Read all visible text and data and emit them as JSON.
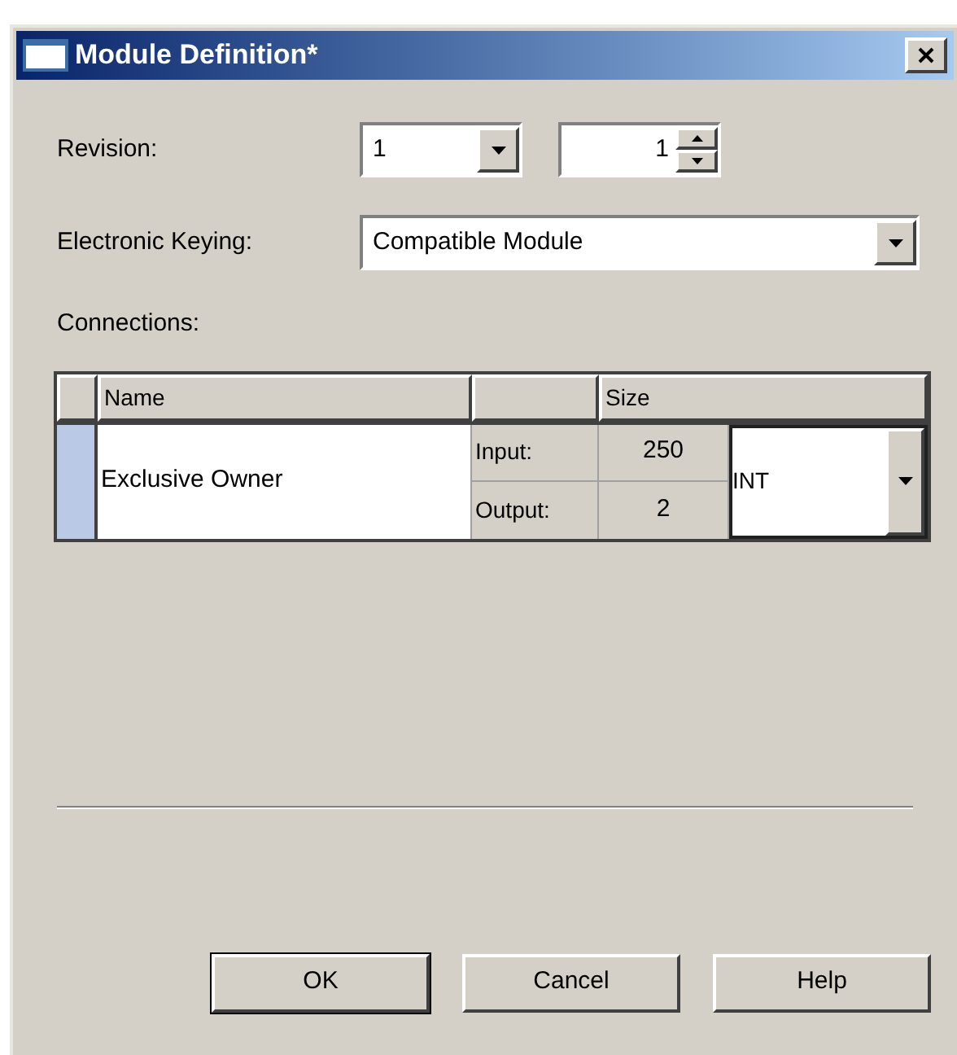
{
  "window": {
    "title": "Module Definition*"
  },
  "revision": {
    "label": "Revision:",
    "major": "1",
    "minor": "1"
  },
  "electronic_keying": {
    "label": "Electronic Keying:",
    "value": "Compatible Module"
  },
  "connections": {
    "label": "Connections:",
    "columns": [
      "Name",
      "Size"
    ],
    "rows": [
      {
        "selected": true,
        "name": "Exclusive Owner",
        "input_label": "Input:",
        "input_size": "250",
        "output_label": "Output:",
        "output_size": "2",
        "data_type": "INT"
      }
    ]
  },
  "buttons": [
    {
      "label": "OK",
      "default": true
    },
    {
      "label": "Cancel",
      "default": false
    },
    {
      "label": "Help",
      "default": false
    }
  ]
}
